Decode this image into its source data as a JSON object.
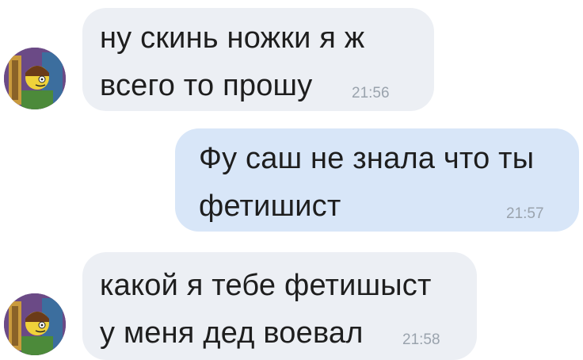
{
  "colors": {
    "incoming_bubble": "#eceff4",
    "outgoing_bubble": "#d8e6f8",
    "text": "#1e1e1e",
    "timestamp": "#9aa3ad"
  },
  "messages": [
    {
      "direction": "incoming",
      "avatar_icon": "cartoon-character-avatar-icon",
      "lines": [
        "ну скинь ножки я ж",
        "всего то прошу"
      ],
      "time": "21:56"
    },
    {
      "direction": "outgoing",
      "lines": [
        "Фу саш не знала что ты",
        "фетишист"
      ],
      "time": "21:57"
    },
    {
      "direction": "incoming",
      "avatar_icon": "cartoon-character-avatar-icon",
      "lines": [
        "какой я тебе фетишыст",
        "у меня дед воевал"
      ],
      "time": "21:58"
    }
  ]
}
